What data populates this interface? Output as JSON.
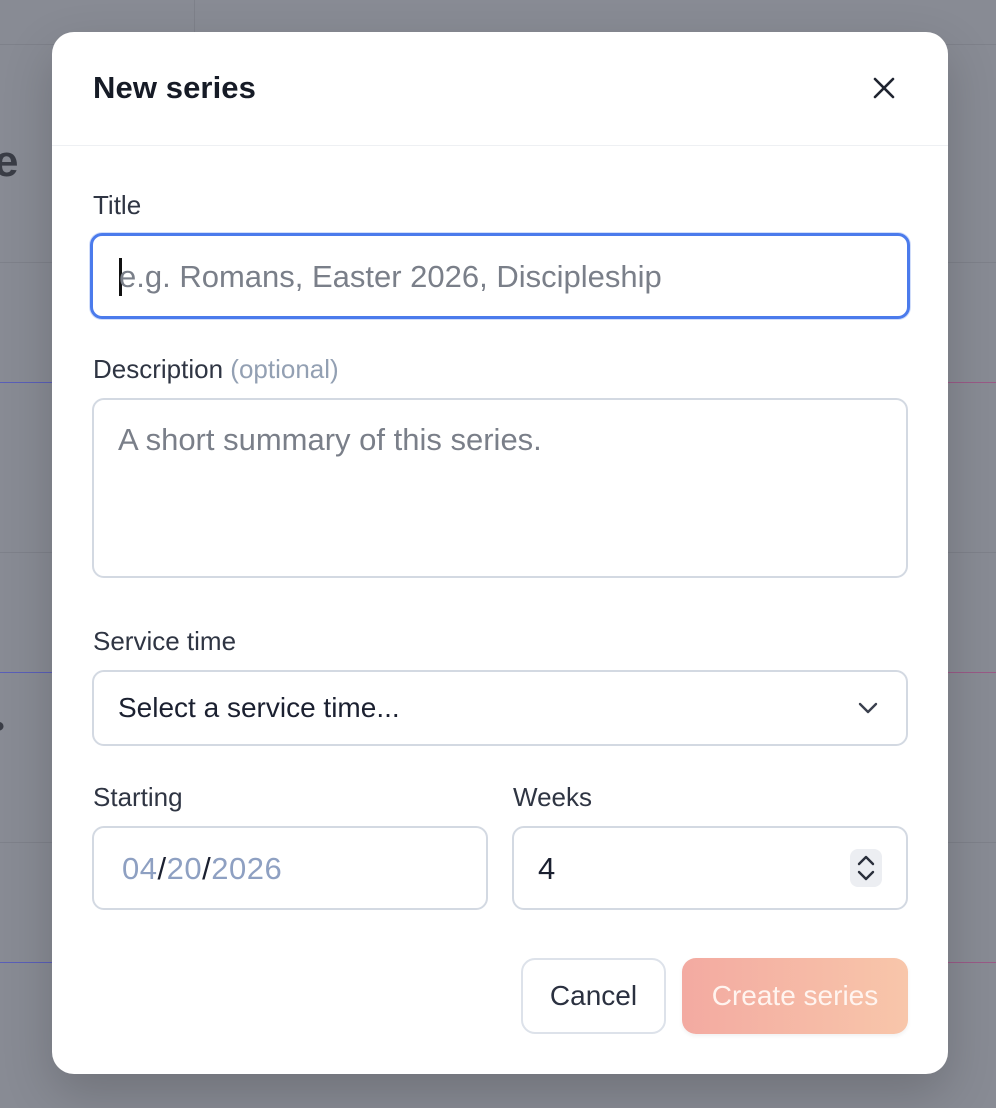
{
  "modal": {
    "title": "New series",
    "close_icon": "close-icon"
  },
  "form": {
    "title": {
      "label": "Title",
      "placeholder": "e.g. Romans, Easter 2026, Discipleship",
      "value": ""
    },
    "description": {
      "label": "Description",
      "optional_label": "(optional)",
      "placeholder": "A short summary of this series.",
      "value": ""
    },
    "service_time": {
      "label": "Service time",
      "selected": "Select a service time...",
      "icon": "chevron-down-icon"
    },
    "starting": {
      "label": "Starting",
      "month": "04",
      "day": "20",
      "year": "2026",
      "separator": "/"
    },
    "weeks": {
      "label": "Weeks",
      "value": "4",
      "icon": "stepper-icon"
    }
  },
  "actions": {
    "cancel_label": "Cancel",
    "create_label": "Create series"
  },
  "colors": {
    "focus_ring": "#4b7bec",
    "primary_gradient_start": "#f3aaa1",
    "primary_gradient_end": "#f8c6aa",
    "overlay": "#888b94"
  }
}
